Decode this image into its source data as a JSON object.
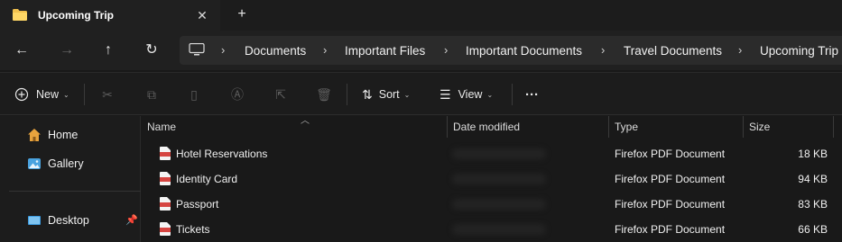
{
  "tab": {
    "title": "Upcoming Trip",
    "close_glyph": "✕",
    "new_tab_glyph": "+"
  },
  "nav": {
    "back": "←",
    "forward": "→",
    "up": "↑",
    "refresh": "↻"
  },
  "address": {
    "crumbs": [
      "Documents",
      "Important Files",
      "Important Documents",
      "Travel Documents",
      "Upcoming Trip"
    ],
    "chevron": "›"
  },
  "toolbar": {
    "new_label": "New",
    "sort_label": "Sort",
    "view_label": "View",
    "more_glyph": "···",
    "caret": "⌄",
    "icons": [
      "cut-icon",
      "copy-icon",
      "paste-icon",
      "rename-icon",
      "share-icon",
      "delete-icon"
    ]
  },
  "sidebar": {
    "items": [
      {
        "label": "Home",
        "icon": "home-icon"
      },
      {
        "label": "Gallery",
        "icon": "gallery-icon"
      },
      {
        "label": "Desktop",
        "icon": "desktop-icon"
      }
    ]
  },
  "columns": [
    "Name",
    "Date modified",
    "Type",
    "Size"
  ],
  "files": [
    {
      "name": "Hotel Reservations",
      "type": "Firefox PDF Document",
      "size": "18 KB"
    },
    {
      "name": "Identity Card",
      "type": "Firefox PDF Document",
      "size": "94 KB"
    },
    {
      "name": "Passport",
      "type": "Firefox PDF Document",
      "size": "83 KB"
    },
    {
      "name": "Tickets",
      "type": "Firefox PDF Document",
      "size": "66 KB"
    }
  ],
  "colors": {
    "folder": "#f2c14e",
    "pdf": "#d64541",
    "home": "#e8a33d",
    "gallery": "#4aa3df",
    "desktop": "#3b9be0"
  }
}
